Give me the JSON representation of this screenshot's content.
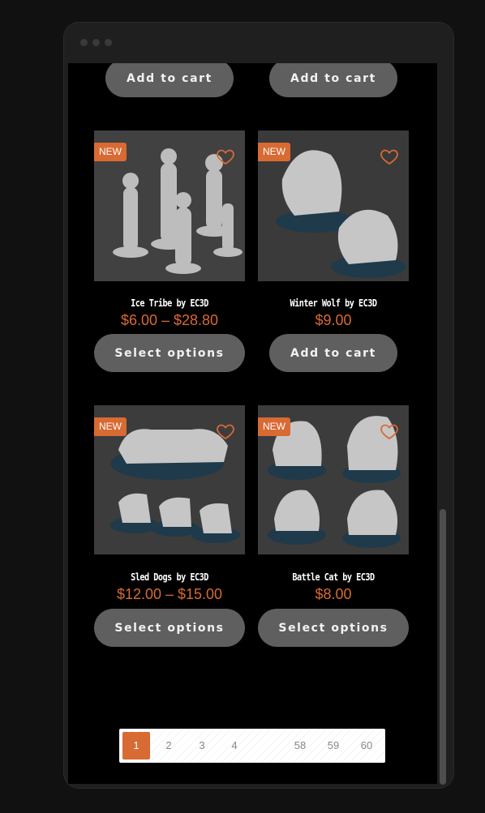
{
  "top_row": {
    "left_button": "Add to cart",
    "right_button": "Add to cart"
  },
  "products": [
    {
      "badge": "NEW",
      "title": "Ice Tribe by EC3D",
      "price": "$6.00 – $28.80",
      "button": "Select options"
    },
    {
      "badge": "NEW",
      "title": "Winter Wolf by EC3D",
      "price": "$9.00",
      "button": "Add to cart"
    },
    {
      "badge": "NEW",
      "title": "Sled Dogs by EC3D",
      "price": "$12.00 – $15.00",
      "button": "Select options"
    },
    {
      "badge": "NEW",
      "title": "Battle Cat by EC3D",
      "price": "$8.00",
      "button": "Select options"
    }
  ],
  "pagination": {
    "pages": [
      "1",
      "2",
      "3",
      "4",
      "58",
      "59",
      "60"
    ],
    "current": "1"
  },
  "colors": {
    "accent": "#d86a33",
    "button": "#5f5f5f",
    "background": "#000000"
  }
}
